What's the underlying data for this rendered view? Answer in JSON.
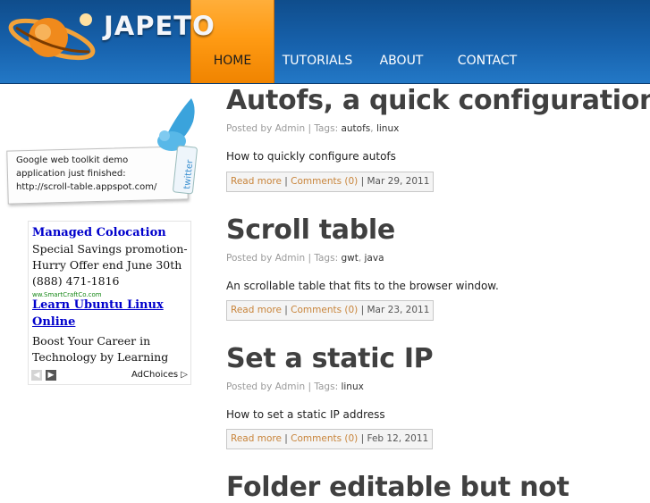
{
  "site": {
    "title": "JAPETO"
  },
  "nav": {
    "items": [
      {
        "label": "HOME",
        "active": true
      },
      {
        "label": "TUTORIALS"
      },
      {
        "label": "ABOUT"
      },
      {
        "label": "CONTACT"
      }
    ]
  },
  "twitter": {
    "badge": "twitter",
    "lines": [
      "Google web toolkit demo",
      "application just finished:",
      "http://scroll-table.appspot.com/"
    ]
  },
  "ad": {
    "items": [
      {
        "title": "Managed Colocation",
        "body": "Special Savings promotion-Hurry Offer end June 30th (888) 471-1816"
      },
      {
        "title": "Learn Ubuntu Linux Online",
        "body": "Boost Your Career in Technology by Learning"
      }
    ],
    "url_fragment": "ww.SmartCraftCo.com",
    "choices": "AdChoices"
  },
  "posts": [
    {
      "title": "Autofs, a quick configuration",
      "meta_prefix": "Posted by Admin | Tags: ",
      "tags": [
        "autofs",
        "linux"
      ],
      "excerpt": "How to quickly configure autofs",
      "read_more": "Read more",
      "comments": "Comments (0)",
      "date": "Mar 29, 2011"
    },
    {
      "title": "Scroll table",
      "meta_prefix": "Posted by Admin | Tags: ",
      "tags": [
        "gwt",
        "java"
      ],
      "excerpt": "An scrollable table that fits to the browser window.",
      "read_more": "Read more",
      "comments": "Comments (0)",
      "date": "Mar 23, 2011"
    },
    {
      "title": "Set a static IP",
      "meta_prefix": "Posted by Admin | Tags: ",
      "tags": [
        "linux"
      ],
      "excerpt": "How to set a static IP address",
      "read_more": "Read more",
      "comments": "Comments (0)",
      "date": "Feb 12, 2011"
    },
    {
      "title": "Folder editable but not"
    }
  ],
  "colors": {
    "header_blue": "#1762ad",
    "nav_active": "#ff9b14",
    "link_orange": "#c8843a",
    "title_gray": "#404040"
  },
  "icons": [
    "planet-logo-icon",
    "twitter-bird-icon",
    "ad-prev-icon",
    "ad-next-icon",
    "adchoices-icon"
  ]
}
